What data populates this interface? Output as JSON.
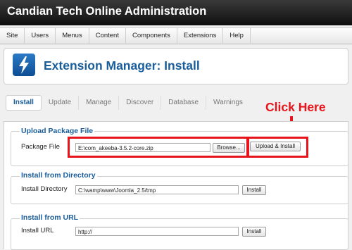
{
  "app": {
    "title": "Candian Tech Online Administration"
  },
  "menu": {
    "items": [
      "Site",
      "Users",
      "Menus",
      "Content",
      "Components",
      "Extensions",
      "Help"
    ]
  },
  "page": {
    "title": "Extension Manager: Install",
    "icon": "lightning-bolt-icon"
  },
  "tabs": {
    "items": [
      "Install",
      "Update",
      "Manage",
      "Discover",
      "Database",
      "Warnings"
    ],
    "active": "Install"
  },
  "annotation": {
    "text": "Click Here",
    "color": "#e8141b"
  },
  "upload": {
    "title": "Upload Package File",
    "label": "Package File",
    "value": "E:\\com_akeeba-3.5.2-core.zip",
    "browse": "Browse...",
    "action": "Upload & Install"
  },
  "directory": {
    "title": "Install from Directory",
    "label": "Install Directory",
    "value": "C:\\wamp\\www\\Joomla_2.5/tmp",
    "action": "Install"
  },
  "url": {
    "title": "Install from URL",
    "label": "Install URL",
    "value": "http://",
    "action": "Install"
  },
  "colors": {
    "brand": "#1a5d9b",
    "highlight": "#e8141b",
    "topbar": "#1c1c1c"
  }
}
